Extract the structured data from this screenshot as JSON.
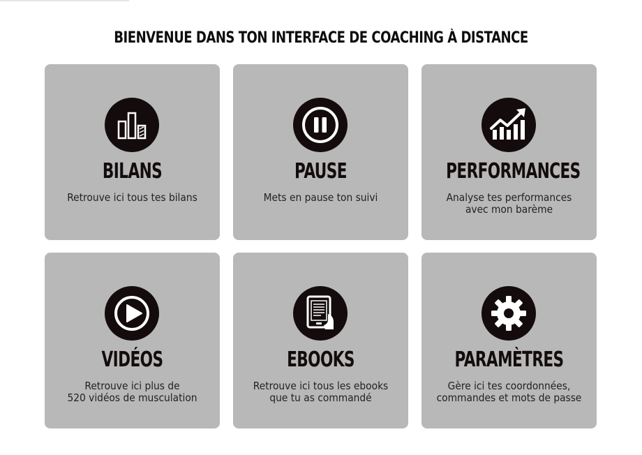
{
  "header": {
    "title": "BIENVENUE DANS TON INTERFACE DE COACHING À DISTANCE"
  },
  "cards": [
    {
      "title": "BILANS",
      "icon": "bar-chart-icon",
      "lines": [
        "Retrouve ici tous tes bilans"
      ]
    },
    {
      "title": "PAUSE",
      "icon": "pause-icon",
      "lines": [
        "Mets en pause ton suivi"
      ]
    },
    {
      "title": "PERFORMANCES",
      "icon": "trend-up-icon",
      "lines": [
        "Analyse tes performances",
        "avec mon barème"
      ]
    },
    {
      "title": "VIDÉOS",
      "icon": "play-icon",
      "lines": [
        "Retrouve ici plus de",
        "520 vidéos de musculation"
      ]
    },
    {
      "title": "EBOOKS",
      "icon": "ebook-reader-icon",
      "lines": [
        "Retrouve ici tous les ebooks",
        "que tu as commandé"
      ]
    },
    {
      "title": "PARAMÈTRES",
      "icon": "gear-icon",
      "lines": [
        "Gère ici tes coordonnées,",
        "commandes et mots de passe"
      ]
    }
  ],
  "colors": {
    "card_background": "#b8b8b8",
    "icon_circle": "#140c0c",
    "text_dark": "#140c0c"
  }
}
